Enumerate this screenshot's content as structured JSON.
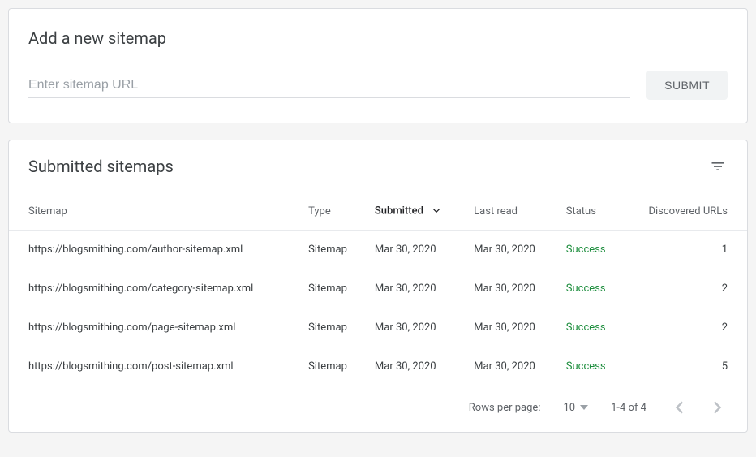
{
  "add": {
    "title": "Add a new sitemap",
    "placeholder": "Enter sitemap URL",
    "submit_label": "SUBMIT"
  },
  "list": {
    "title": "Submitted sitemaps",
    "columns": {
      "sitemap": "Sitemap",
      "type": "Type",
      "submitted": "Submitted",
      "last_read": "Last read",
      "status": "Status",
      "discovered": "Discovered URLs"
    },
    "rows": [
      {
        "sitemap": "https://blogsmithing.com/author-sitemap.xml",
        "type": "Sitemap",
        "submitted": "Mar 30, 2020",
        "last_read": "Mar 30, 2020",
        "status": "Success",
        "discovered": "1"
      },
      {
        "sitemap": "https://blogsmithing.com/category-sitemap.xml",
        "type": "Sitemap",
        "submitted": "Mar 30, 2020",
        "last_read": "Mar 30, 2020",
        "status": "Success",
        "discovered": "2"
      },
      {
        "sitemap": "https://blogsmithing.com/page-sitemap.xml",
        "type": "Sitemap",
        "submitted": "Mar 30, 2020",
        "last_read": "Mar 30, 2020",
        "status": "Success",
        "discovered": "2"
      },
      {
        "sitemap": "https://blogsmithing.com/post-sitemap.xml",
        "type": "Sitemap",
        "submitted": "Mar 30, 2020",
        "last_read": "Mar 30, 2020",
        "status": "Success",
        "discovered": "5"
      }
    ]
  },
  "pagination": {
    "rows_label": "Rows per page:",
    "rows_value": "10",
    "range": "1-4 of 4"
  }
}
